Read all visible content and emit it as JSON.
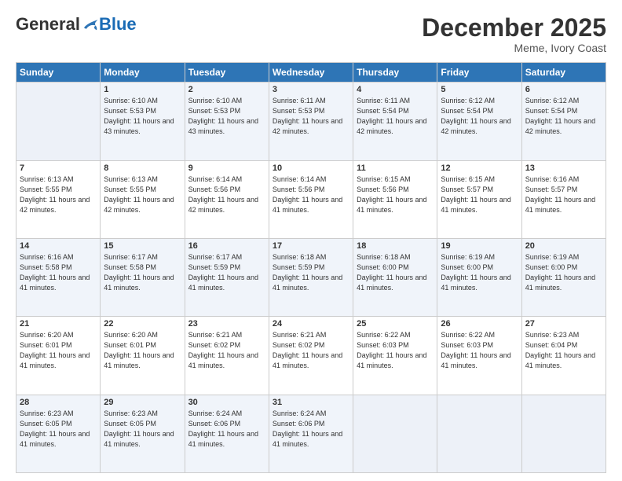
{
  "logo": {
    "general": "General",
    "blue": "Blue"
  },
  "title": "December 2025",
  "location": "Meme, Ivory Coast",
  "days_of_week": [
    "Sunday",
    "Monday",
    "Tuesday",
    "Wednesday",
    "Thursday",
    "Friday",
    "Saturday"
  ],
  "weeks": [
    [
      {
        "day": "",
        "sunrise": "",
        "sunset": "",
        "daylight": "",
        "empty": true
      },
      {
        "day": "1",
        "sunrise": "6:10 AM",
        "sunset": "5:53 PM",
        "daylight": "11 hours and 43 minutes."
      },
      {
        "day": "2",
        "sunrise": "6:10 AM",
        "sunset": "5:53 PM",
        "daylight": "11 hours and 43 minutes."
      },
      {
        "day": "3",
        "sunrise": "6:11 AM",
        "sunset": "5:53 PM",
        "daylight": "11 hours and 42 minutes."
      },
      {
        "day": "4",
        "sunrise": "6:11 AM",
        "sunset": "5:54 PM",
        "daylight": "11 hours and 42 minutes."
      },
      {
        "day": "5",
        "sunrise": "6:12 AM",
        "sunset": "5:54 PM",
        "daylight": "11 hours and 42 minutes."
      },
      {
        "day": "6",
        "sunrise": "6:12 AM",
        "sunset": "5:54 PM",
        "daylight": "11 hours and 42 minutes."
      }
    ],
    [
      {
        "day": "7",
        "sunrise": "6:13 AM",
        "sunset": "5:55 PM",
        "daylight": "11 hours and 42 minutes."
      },
      {
        "day": "8",
        "sunrise": "6:13 AM",
        "sunset": "5:55 PM",
        "daylight": "11 hours and 42 minutes."
      },
      {
        "day": "9",
        "sunrise": "6:14 AM",
        "sunset": "5:56 PM",
        "daylight": "11 hours and 42 minutes."
      },
      {
        "day": "10",
        "sunrise": "6:14 AM",
        "sunset": "5:56 PM",
        "daylight": "11 hours and 41 minutes."
      },
      {
        "day": "11",
        "sunrise": "6:15 AM",
        "sunset": "5:56 PM",
        "daylight": "11 hours and 41 minutes."
      },
      {
        "day": "12",
        "sunrise": "6:15 AM",
        "sunset": "5:57 PM",
        "daylight": "11 hours and 41 minutes."
      },
      {
        "day": "13",
        "sunrise": "6:16 AM",
        "sunset": "5:57 PM",
        "daylight": "11 hours and 41 minutes."
      }
    ],
    [
      {
        "day": "14",
        "sunrise": "6:16 AM",
        "sunset": "5:58 PM",
        "daylight": "11 hours and 41 minutes."
      },
      {
        "day": "15",
        "sunrise": "6:17 AM",
        "sunset": "5:58 PM",
        "daylight": "11 hours and 41 minutes."
      },
      {
        "day": "16",
        "sunrise": "6:17 AM",
        "sunset": "5:59 PM",
        "daylight": "11 hours and 41 minutes."
      },
      {
        "day": "17",
        "sunrise": "6:18 AM",
        "sunset": "5:59 PM",
        "daylight": "11 hours and 41 minutes."
      },
      {
        "day": "18",
        "sunrise": "6:18 AM",
        "sunset": "6:00 PM",
        "daylight": "11 hours and 41 minutes."
      },
      {
        "day": "19",
        "sunrise": "6:19 AM",
        "sunset": "6:00 PM",
        "daylight": "11 hours and 41 minutes."
      },
      {
        "day": "20",
        "sunrise": "6:19 AM",
        "sunset": "6:00 PM",
        "daylight": "11 hours and 41 minutes."
      }
    ],
    [
      {
        "day": "21",
        "sunrise": "6:20 AM",
        "sunset": "6:01 PM",
        "daylight": "11 hours and 41 minutes."
      },
      {
        "day": "22",
        "sunrise": "6:20 AM",
        "sunset": "6:01 PM",
        "daylight": "11 hours and 41 minutes."
      },
      {
        "day": "23",
        "sunrise": "6:21 AM",
        "sunset": "6:02 PM",
        "daylight": "11 hours and 41 minutes."
      },
      {
        "day": "24",
        "sunrise": "6:21 AM",
        "sunset": "6:02 PM",
        "daylight": "11 hours and 41 minutes."
      },
      {
        "day": "25",
        "sunrise": "6:22 AM",
        "sunset": "6:03 PM",
        "daylight": "11 hours and 41 minutes."
      },
      {
        "day": "26",
        "sunrise": "6:22 AM",
        "sunset": "6:03 PM",
        "daylight": "11 hours and 41 minutes."
      },
      {
        "day": "27",
        "sunrise": "6:23 AM",
        "sunset": "6:04 PM",
        "daylight": "11 hours and 41 minutes."
      }
    ],
    [
      {
        "day": "28",
        "sunrise": "6:23 AM",
        "sunset": "6:05 PM",
        "daylight": "11 hours and 41 minutes."
      },
      {
        "day": "29",
        "sunrise": "6:23 AM",
        "sunset": "6:05 PM",
        "daylight": "11 hours and 41 minutes."
      },
      {
        "day": "30",
        "sunrise": "6:24 AM",
        "sunset": "6:06 PM",
        "daylight": "11 hours and 41 minutes."
      },
      {
        "day": "31",
        "sunrise": "6:24 AM",
        "sunset": "6:06 PM",
        "daylight": "11 hours and 41 minutes."
      },
      {
        "day": "",
        "sunrise": "",
        "sunset": "",
        "daylight": "",
        "empty": true
      },
      {
        "day": "",
        "sunrise": "",
        "sunset": "",
        "daylight": "",
        "empty": true
      },
      {
        "day": "",
        "sunrise": "",
        "sunset": "",
        "daylight": "",
        "empty": true
      }
    ]
  ]
}
